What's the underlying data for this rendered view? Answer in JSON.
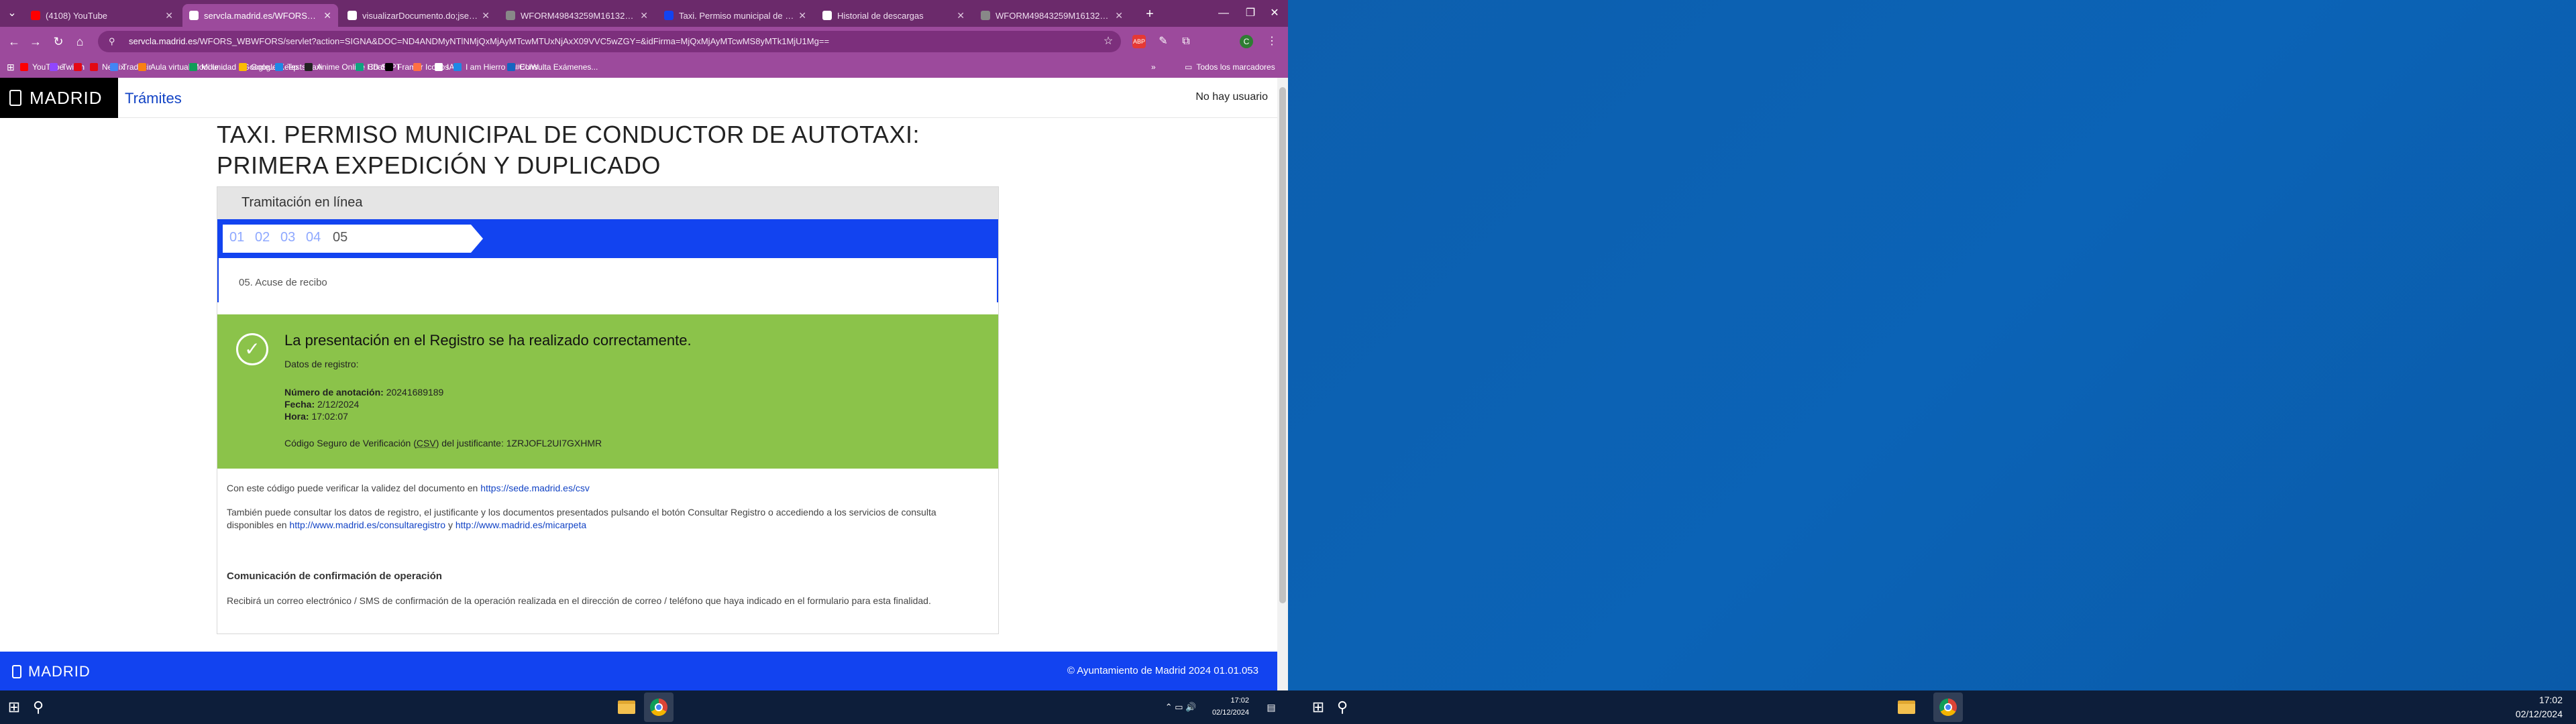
{
  "browser": {
    "tabs": [
      {
        "label": "(4108) YouTube",
        "color": "#ff0000"
      },
      {
        "label": "servcla.madrid.es/WFORS_WBWFORS/servlet?action",
        "color": "#ffffff",
        "active": true
      },
      {
        "label": "visualizarDocumento.do;jsessionid",
        "color": "#ffffff"
      },
      {
        "label": "WFORM49843259M16132279",
        "color": "#888888"
      },
      {
        "label": "Taxi. Permiso municipal de conductor",
        "color": "#1243f0"
      },
      {
        "label": "Historial de descargas",
        "color": "#ffffff"
      },
      {
        "label": "WFORM49843259M16132279",
        "color": "#888888"
      }
    ],
    "url_host": "servcla.madrid.es",
    "url_path": "/WFORS_WBWFORS/servlet?action=SIGNA&DOC=ND4ANDMyNTlNMjQxMjAyMTcwMTUxNjAxX09VVC5wZGY=&idFirma=MjQxMjAyMTcwMS8yMTk1MjU1Mg==",
    "bookmarks": [
      {
        "label": "YouTube",
        "color": "#ff0000"
      },
      {
        "label": "Twitch",
        "color": "#9146ff"
      },
      {
        "label": "",
        "color": "#e50914"
      },
      {
        "label": "Netflix",
        "color": "#e50914"
      },
      {
        "label": "Traducir",
        "color": "#4285f4"
      },
      {
        "label": "Aula virtual Moodle...",
        "color": "#f98012"
      },
      {
        "label": "Mi unidad - Google...",
        "color": "#0f9d58"
      },
      {
        "label": "Google Keep",
        "color": "#fbbc04"
      },
      {
        "label": "Tests Taxi",
        "color": "#1e88e5"
      },
      {
        "label": "Anime Online HD S...",
        "color": "#222222"
      },
      {
        "label": "ChatGPT",
        "color": "#10a37f"
      },
      {
        "label": "Framer",
        "color": "#000000"
      },
      {
        "label": "Iconos",
        "color": "#ff7043"
      },
      {
        "label": "IAs",
        "color": "#ffffff"
      },
      {
        "label": "I am Hierro IV#EUW...",
        "color": "#1e88e5"
      },
      {
        "label": "Consulta Exámenes...",
        "color": "#1565c0"
      }
    ],
    "all_bookmarks": "Todos los marcadores"
  },
  "site": {
    "logo": "MADRID",
    "section": "Trámites",
    "user": "No hay usuario",
    "title_line1": "TAXI. PERMISO MUNICIPAL DE CONDUCTOR DE AUTOTAXI:",
    "title_line2": "PRIMERA EXPEDICIÓN Y DUPLICADO",
    "tramitacion": "Tramitación en línea",
    "steps": [
      "01",
      "02",
      "03",
      "04",
      "05"
    ],
    "current_step_label": "05. Acuse de recibo",
    "success_title": "La presentación en el Registro se ha realizado correctamente.",
    "datos_registro": "Datos de registro:",
    "num_anotacion_label": "Número de anotación:",
    "num_anotacion": "20241689189",
    "fecha_label": "Fecha:",
    "fecha": "2/12/2024",
    "hora_label": "Hora:",
    "hora": "17:02:07",
    "csv_text_pre": "Código Seguro de Verificación (",
    "csv_abbr": "CSV",
    "csv_text_post": ") del justificante:",
    "csv_code": "1ZRJOFL2UI7GXHMR",
    "verify_text": "Con este código puede verificar la validez del documento en",
    "verify_link": "https://sede.madrid.es/csv",
    "consult_text": "También puede consultar los datos de registro, el justificante y los documentos presentados pulsando el botón Consultar Registro o accediendo a los servicios de consulta disponibles en",
    "consult_link1": "http://www.madrid.es/consultaregistro",
    "consult_and": "y",
    "consult_link2": "http://www.madrid.es/micarpeta",
    "com_title": "Comunicación de confirmación de operación",
    "com_text": "Recibirá un correo electrónico / SMS de confirmación de la operación realizada en el dirección de correo / teléfono que haya indicado en el formulario para esta finalidad.",
    "footer_logo": "MADRID",
    "copyright": "© Ayuntamiento de Madrid 2024 01.01.053"
  },
  "taskbar": {
    "left_time": "17:02",
    "left_date": "02/12/2024",
    "right_time": "17:02",
    "right_date": "02/12/2024"
  }
}
